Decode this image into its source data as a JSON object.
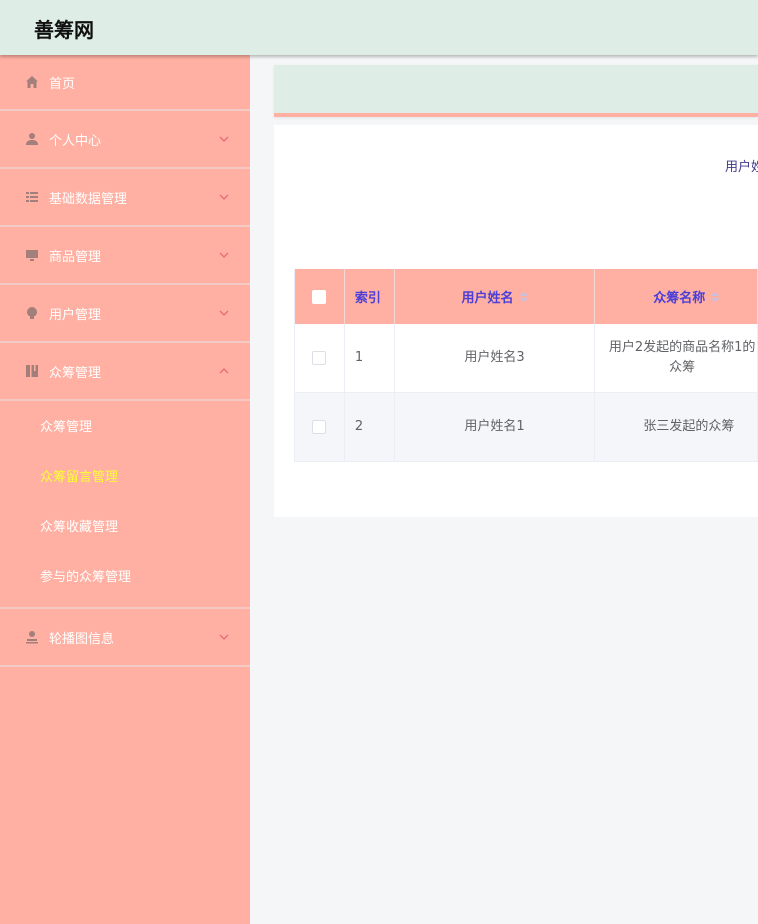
{
  "header": {
    "brand": "善筹网"
  },
  "sidebar": {
    "items": [
      {
        "label": "首页",
        "icon": "home-icon",
        "expandable": false
      },
      {
        "label": "个人中心",
        "icon": "user-icon",
        "expandable": true
      },
      {
        "label": "基础数据管理",
        "icon": "list-icon",
        "expandable": true
      },
      {
        "label": "商品管理",
        "icon": "monitor-icon",
        "expandable": true
      },
      {
        "label": "用户管理",
        "icon": "bulb-icon",
        "expandable": true
      },
      {
        "label": "众筹管理",
        "icon": "book-icon",
        "expandable": true,
        "expanded": true
      },
      {
        "label": "轮播图信息",
        "icon": "person-icon",
        "expandable": true
      }
    ],
    "submenu": [
      {
        "label": "众筹管理"
      },
      {
        "label": "众筹留言管理",
        "active": true
      },
      {
        "label": "众筹收藏管理"
      },
      {
        "label": "参与的众筹管理"
      }
    ]
  },
  "search": {
    "label": "用户姓"
  },
  "table": {
    "columns": [
      "索引",
      "用户姓名",
      "众筹名称"
    ],
    "rows": [
      {
        "index": "1",
        "name": "用户姓名3",
        "title": "用户2发起的商品名称1的众筹"
      },
      {
        "index": "2",
        "name": "用户姓名1",
        "title": "张三发起的众筹"
      }
    ]
  },
  "colors": {
    "sidebar": "#ffb0a2",
    "header": "#deede6",
    "active": "#ffff33",
    "headerText": "#4b3fd8"
  }
}
